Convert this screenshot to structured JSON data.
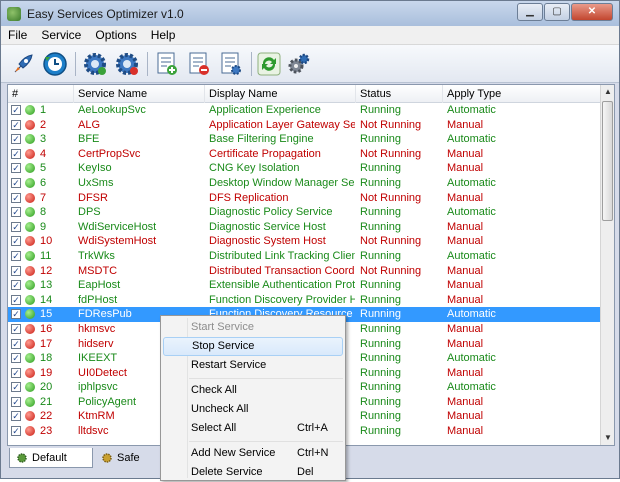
{
  "window": {
    "title": "Easy Services Optimizer v1.0"
  },
  "menu": [
    "File",
    "Service",
    "Options",
    "Help"
  ],
  "toolbar_icons": [
    "rocket-icon",
    "restore-clock-icon",
    "gear-blue-icon",
    "gear-red-icon",
    "list-add-icon",
    "list-remove-icon",
    "list-settings-icon",
    "refresh-icon",
    "settings-icon"
  ],
  "columns": {
    "num": "#",
    "service_name": "Service Name",
    "display_name": "Display Name",
    "status": "Status",
    "apply_type": "Apply Type"
  },
  "rows": [
    {
      "num": "1",
      "svc": "AeLookupSvc",
      "disp": "Application Experience",
      "status": "Running",
      "type": "Automatic",
      "state": "green"
    },
    {
      "num": "2",
      "svc": "ALG",
      "disp": "Application Layer Gateway Ser...",
      "status": "Not Running",
      "type": "Manual",
      "state": "red"
    },
    {
      "num": "3",
      "svc": "BFE",
      "disp": "Base Filtering Engine",
      "status": "Running",
      "type": "Automatic",
      "state": "green"
    },
    {
      "num": "4",
      "svc": "CertPropSvc",
      "disp": "Certificate Propagation",
      "status": "Not Running",
      "type": "Manual",
      "state": "red"
    },
    {
      "num": "5",
      "svc": "KeyIso",
      "disp": "CNG Key Isolation",
      "status": "Running",
      "type": "Manual",
      "state": "green"
    },
    {
      "num": "6",
      "svc": "UxSms",
      "disp": "Desktop Window Manager Sess...",
      "status": "Running",
      "type": "Automatic",
      "state": "green"
    },
    {
      "num": "7",
      "svc": "DFSR",
      "disp": "DFS Replication",
      "status": "Not Running",
      "type": "Manual",
      "state": "red"
    },
    {
      "num": "8",
      "svc": "DPS",
      "disp": "Diagnostic Policy Service",
      "status": "Running",
      "type": "Automatic",
      "state": "green"
    },
    {
      "num": "9",
      "svc": "WdiServiceHost",
      "disp": "Diagnostic Service Host",
      "status": "Running",
      "type": "Manual",
      "state": "green"
    },
    {
      "num": "10",
      "svc": "WdiSystemHost",
      "disp": "Diagnostic System Host",
      "status": "Not Running",
      "type": "Manual",
      "state": "red"
    },
    {
      "num": "11",
      "svc": "TrkWks",
      "disp": "Distributed Link Tracking Client",
      "status": "Running",
      "type": "Automatic",
      "state": "green"
    },
    {
      "num": "12",
      "svc": "MSDTC",
      "disp": "Distributed Transaction Coordin...",
      "status": "Not Running",
      "type": "Manual",
      "state": "red"
    },
    {
      "num": "13",
      "svc": "EapHost",
      "disp": "Extensible Authentication Proto...",
      "status": "Running",
      "type": "Manual",
      "state": "green"
    },
    {
      "num": "14",
      "svc": "fdPHost",
      "disp": "Function Discovery Provider Host",
      "status": "Running",
      "type": "Manual",
      "state": "green"
    },
    {
      "num": "15",
      "svc": "FDResPub",
      "disp": "Function Discovery Resource P...",
      "status": "Running",
      "type": "Automatic",
      "state": "green",
      "selected": true
    },
    {
      "num": "16",
      "svc": "hkmsvc",
      "disp": "",
      "status": "Running",
      "type": "Manual",
      "state": "red"
    },
    {
      "num": "17",
      "svc": "hidserv",
      "disp": "",
      "status": "Running",
      "type": "Manual",
      "state": "red"
    },
    {
      "num": "18",
      "svc": "IKEEXT",
      "disp": "",
      "status": "Running",
      "type": "Automatic",
      "state": "green"
    },
    {
      "num": "19",
      "svc": "UI0Detect",
      "disp": "",
      "status": "Running",
      "type": "Manual",
      "state": "red"
    },
    {
      "num": "20",
      "svc": "iphlpsvc",
      "disp": "",
      "status": "Running",
      "type": "Automatic",
      "state": "green"
    },
    {
      "num": "21",
      "svc": "PolicyAgent",
      "disp": "",
      "status": "Running",
      "type": "Manual",
      "state": "green"
    },
    {
      "num": "22",
      "svc": "KtmRM",
      "disp": "",
      "status": "Running",
      "type": "Manual",
      "state": "red"
    },
    {
      "num": "23",
      "svc": "lltdsvc",
      "disp": "",
      "status": "Running",
      "type": "Manual",
      "state": "red"
    }
  ],
  "tabs": {
    "default": "Default",
    "safe": "Safe"
  },
  "context_menu": {
    "start": "Start Service",
    "stop": "Stop Service",
    "restart": "Restart Service",
    "check_all": "Check All",
    "uncheck_all": "Uncheck All",
    "select_all": "Select All",
    "select_all_shortcut": "Ctrl+A",
    "add_new": "Add New Service",
    "add_new_shortcut": "Ctrl+N",
    "delete": "Delete Service",
    "delete_shortcut": "Del"
  },
  "colors": {
    "running": "#1a8a1a",
    "not_running": "#c00000",
    "selection": "#3399ff"
  }
}
